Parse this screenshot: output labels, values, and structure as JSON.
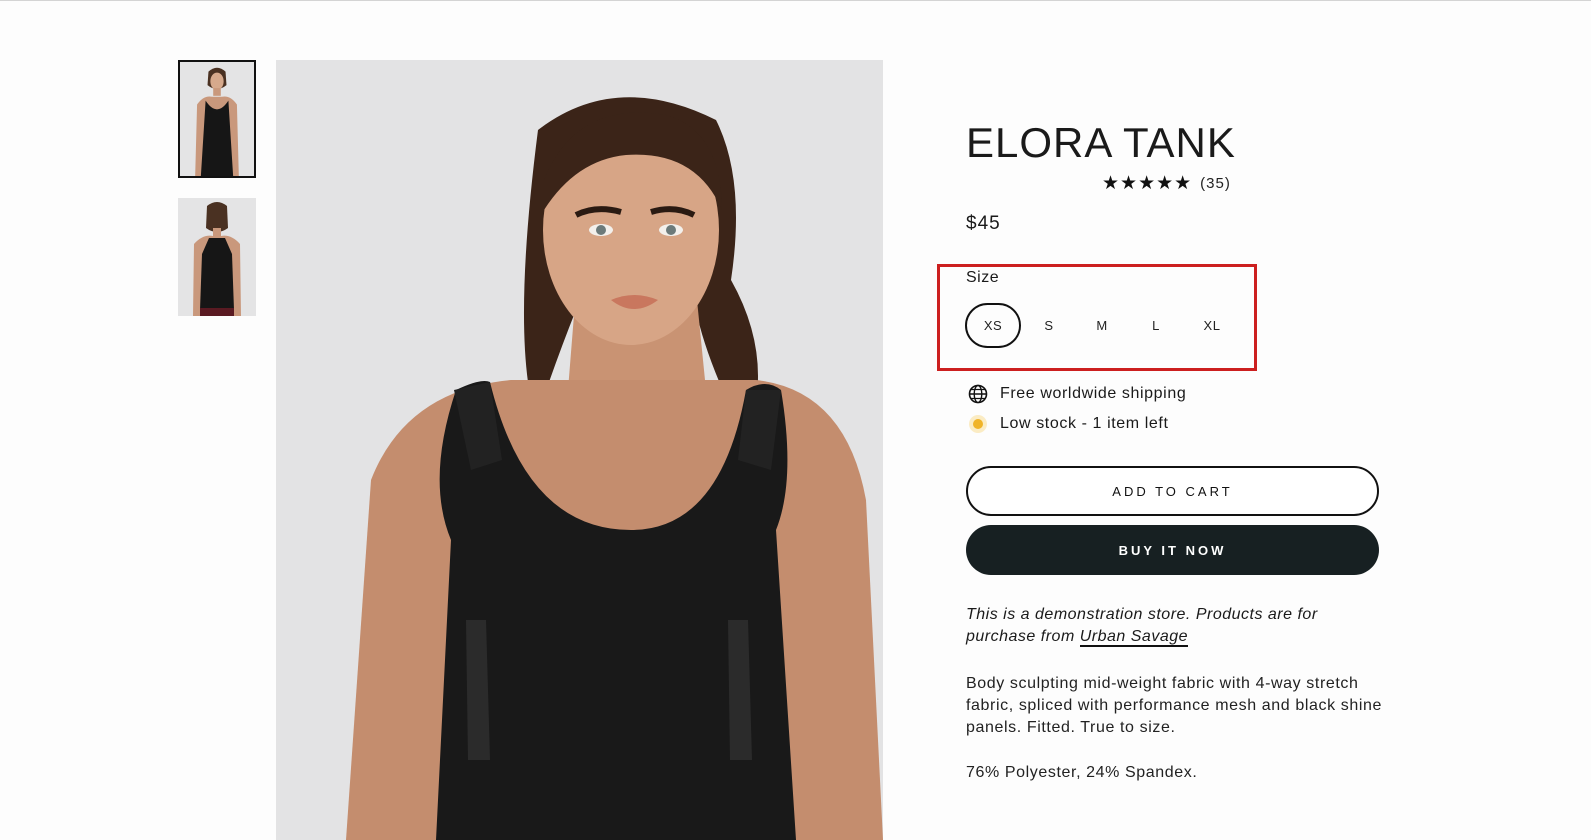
{
  "product": {
    "title": "ELORA TANK",
    "rating": {
      "stars": "★★★★★",
      "count": "(35)"
    },
    "price": "$45"
  },
  "size": {
    "label": "Size",
    "options": [
      "XS",
      "S",
      "M",
      "L",
      "XL"
    ],
    "selected": "XS"
  },
  "info": {
    "shipping": "Free worldwide shipping",
    "stock": "Low stock - 1 item left"
  },
  "buttons": {
    "add_to_cart": "ADD TO CART",
    "buy_now": "BUY IT NOW"
  },
  "demo_note": {
    "text": "This is a demonstration store. Products are for purchase from ",
    "link": "Urban Savage"
  },
  "description": "Body sculpting mid-weight fabric with 4-way stretch fabric, spliced with performance mesh and black shine panels. Fitted. True to size.",
  "material": "76% Polyester, 24% Spandex.",
  "colors": {
    "accent": "#172022",
    "highlight_box": "#cc1f1f",
    "stock_dot": "#f0b429",
    "image_background": "#e3e3e4"
  },
  "icons": {
    "shipping": "globe-icon",
    "stock": "stock-dot-icon"
  }
}
